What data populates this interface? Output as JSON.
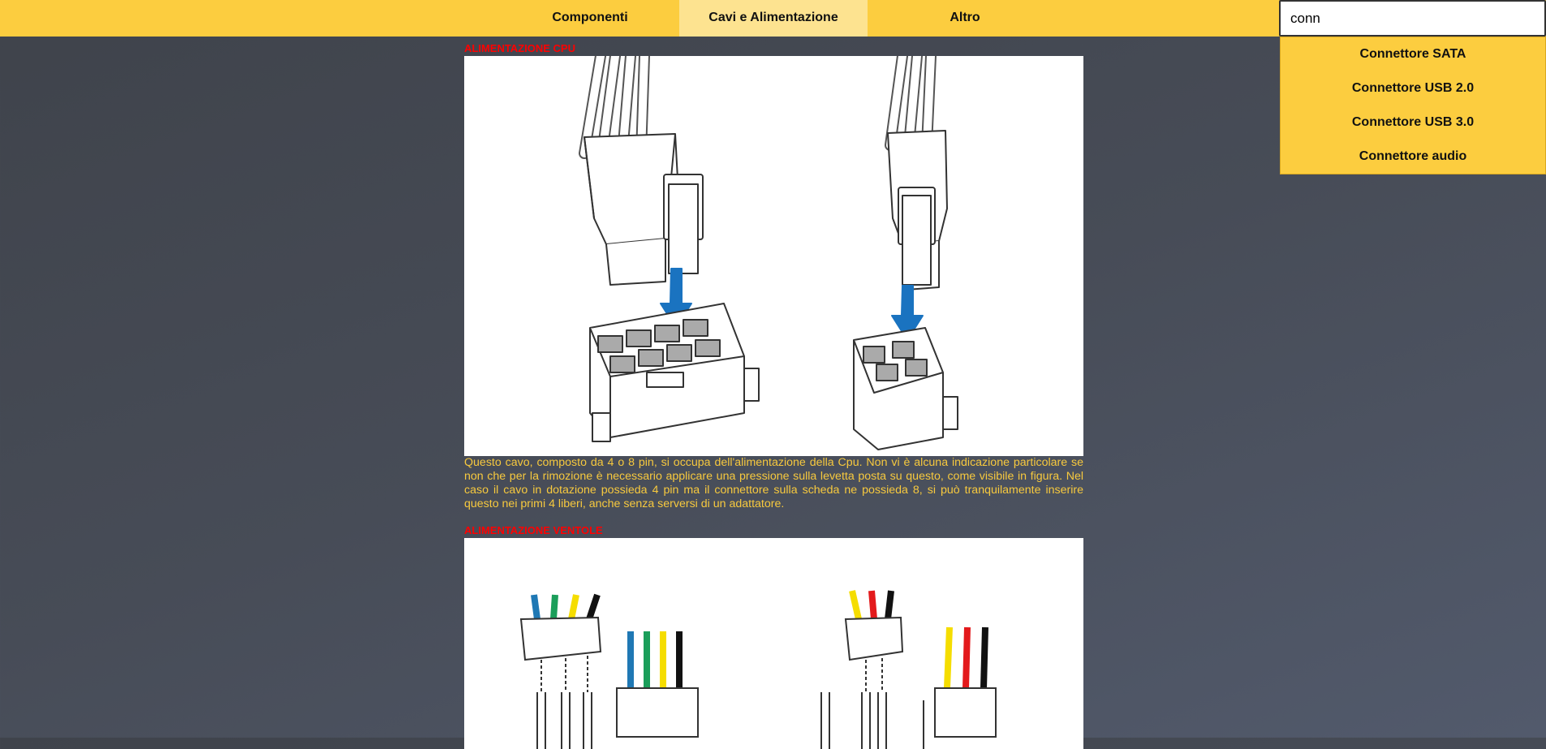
{
  "nav": {
    "items": [
      {
        "label": "Componenti"
      },
      {
        "label": "Cavi e Alimentazione",
        "active": true
      },
      {
        "label": "Altro"
      }
    ]
  },
  "search": {
    "value": "conn",
    "suggestions": [
      "Connettore SATA",
      "Connettore USB 2.0",
      "Connettore USB 3.0",
      "Connettore audio"
    ]
  },
  "sections": [
    {
      "title": "ALIMENTAZIONE CPU",
      "description": "Questo cavo, composto da 4 o 8 pin, si occupa dell'alimentazione della Cpu. Non vi è alcuna indicazione particolare se non che per la rimozione è necessario applicare una pressione sulla levetta posta su questo, come visibile in figura. Nel caso il cavo in dotazione possieda 4 pin ma il connettore sulla scheda ne possieda 8, si può tranquilamente inserire questo nei primi 4 liberi, anche senza serversi di un adattatore."
    },
    {
      "title": "ALIMENTAZIONE VENTOLE"
    }
  ],
  "colors": {
    "nav_bg": "#fccd3f",
    "nav_active_bg": "#fde390",
    "section_title": "#ff0000",
    "body_text": "#f7c93e",
    "arrow": "#1a73c0",
    "wire_blue": "#1f78b4",
    "wire_green": "#1b9e5a",
    "wire_yellow": "#f5dd00",
    "wire_black": "#111111",
    "wire_red": "#e31a1c"
  }
}
